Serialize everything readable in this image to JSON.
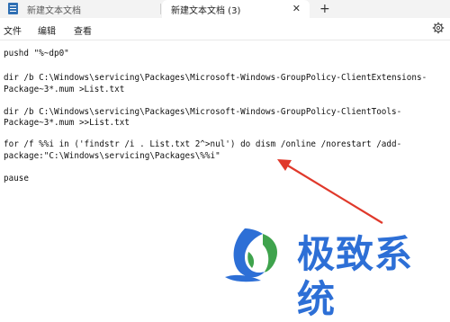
{
  "tabs": [
    {
      "label": "新建文本文档",
      "active": false
    },
    {
      "label": "新建文本文档 (3)",
      "active": true,
      "close": "✕"
    }
  ],
  "new_tab": "+",
  "menu": [
    "文件",
    "编辑",
    "查看"
  ],
  "editor_lines": [
    "pushd \"%~dp0\"",
    "",
    "dir /b C:\\Windows\\servicing\\Packages\\Microsoft-Windows-GroupPolicy-ClientExtensions-",
    "Package~3*.mum >List.txt",
    "",
    "dir /b C:\\Windows\\servicing\\Packages\\Microsoft-Windows-GroupPolicy-ClientTools-",
    "Package~3*.mum >>List.txt",
    "",
    "for /f %%i in ('findstr /i . List.txt 2^>nul') do dism /online /norestart /add-",
    "package:\"C:\\Windows\\servicing\\Packages\\%%i\"",
    "",
    "pause"
  ],
  "icons": {
    "app": "notepad-icon",
    "settings": "gear-icon"
  },
  "watermark": {
    "text": "极致系统",
    "color": "#2d6fd6"
  },
  "colors": {
    "arrow": "#e0392b"
  }
}
